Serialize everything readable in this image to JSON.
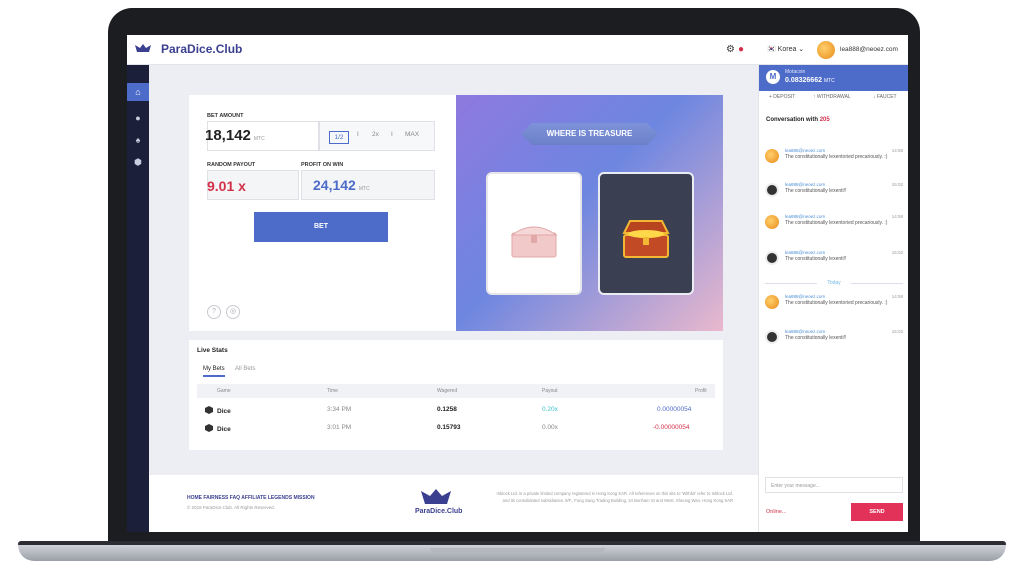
{
  "app": {
    "brand": "ParaDice.Club"
  },
  "topbar": {
    "language": "Korea",
    "email": "lea888@neoez.com",
    "flag_icon": "korea-flag-icon",
    "badge_icon": "notification-icon"
  },
  "sidebar": {
    "items": [
      {
        "icon": "home-icon"
      },
      {
        "icon": "dice-icon"
      },
      {
        "icon": "spade-icon"
      },
      {
        "icon": "cube-icon"
      }
    ]
  },
  "game": {
    "bet_amount_label": "BET AMOUNT",
    "bet_amount": "18,142",
    "unit": "MTC",
    "half": "1/2",
    "sep1": "I",
    "double": "2x",
    "sep2": "I",
    "max": "MAX",
    "random_payout_label": "RANDOM PAYOUT",
    "random_payout": "9.01 x",
    "profit_label": "PROFIT ON WIN",
    "profit": "24,142",
    "bet_button": "BET",
    "help_icon": "?",
    "eye_icon": "◎",
    "treasure_title": "WHERE IS TREASURE"
  },
  "stats": {
    "title": "Live Stats",
    "tabs": [
      "My Bets",
      "All Bets"
    ],
    "columns": [
      "Game",
      "Time",
      "Wagered",
      "Payout",
      "Profit"
    ],
    "rows": [
      {
        "game": "Dice",
        "time": "3:34 PM",
        "wagered": "0.1258",
        "payout": "0.20x",
        "profit": "0.00000054"
      },
      {
        "game": "Dice",
        "time": "3:01 PM",
        "wagered": "0.15793",
        "payout": "0.00x",
        "profit": "-0.00000054"
      }
    ]
  },
  "footer": {
    "links": [
      "HOME",
      "FAIRNESS",
      "FAQ",
      "AFFILIATE",
      "LEGENDS",
      "MISSION"
    ],
    "copyright": "© 2018 ParaDice.Club. All Rights Reserved.",
    "brand": "ParaDice.Club",
    "desc": "Inblock Ltd. is a private limited company registered in Hong Kong SAR. All references on this site to 'Withbit' refer to Inblock Ltd. and its consolidated subsidiaries. 9/F., Fung Sang Trading Building, 34 Bonham St and West, Sheung Wan, Hong Kong SAR"
  },
  "chat": {
    "wallet_name": "Motacoin",
    "wallet_balance": "0.08326662",
    "wallet_unit": "MTC",
    "deposit": "+ DEPOSIT",
    "withdrawal": "↑ WITHDRAWAL",
    "faucet": "↓ FAUCET",
    "conversation_label": "Conversation with",
    "conversation_count": "205",
    "messages": [
      {
        "user": "lea888@neoez.com",
        "time": "14:58",
        "text": "The constitutionally lexentoried precariously. :)",
        "avatar": "orange"
      },
      {
        "user": "lea888@neoez.com",
        "time": "15:02",
        "text": "The constitutionally lexenti!!",
        "avatar": "black"
      },
      {
        "user": "lea888@neoez.com",
        "time": "14:58",
        "text": "The constitutionally lexentoried precariously. :)",
        "avatar": "orange"
      },
      {
        "user": "lea888@neoez.com",
        "time": "15:02",
        "text": "The constitutionally lexenti!!",
        "avatar": "black"
      },
      {
        "user": "lea888@neoez.com",
        "time": "14:58",
        "text": "The constitutionally lexentoried precariously. :)",
        "avatar": "orange"
      },
      {
        "user": "lea888@neoez.com",
        "time": "15:02",
        "text": "The constitutionally lexenti!!",
        "avatar": "black"
      }
    ],
    "today": "Today",
    "input_placeholder": "Enter your message...",
    "online": "Online...",
    "send": "SEND"
  }
}
